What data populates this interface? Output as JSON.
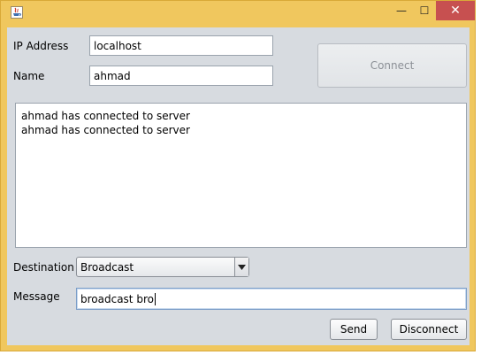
{
  "window": {
    "title": "",
    "buttons": {
      "minimize": "—",
      "maximize": "☐",
      "close": "✕"
    }
  },
  "form": {
    "ip_label": "IP Address",
    "ip_value": "localhost",
    "name_label": "Name",
    "name_value": "ahmad",
    "connect_label": "Connect"
  },
  "log": {
    "lines": [
      "ahmad has connected to server",
      "ahmad has connected to server"
    ]
  },
  "destination": {
    "label": "Destination",
    "selected": "Broadcast"
  },
  "message": {
    "label": "Message",
    "value": "broadcast bro"
  },
  "actions": {
    "send_label": "Send",
    "disconnect_label": "Disconnect"
  }
}
